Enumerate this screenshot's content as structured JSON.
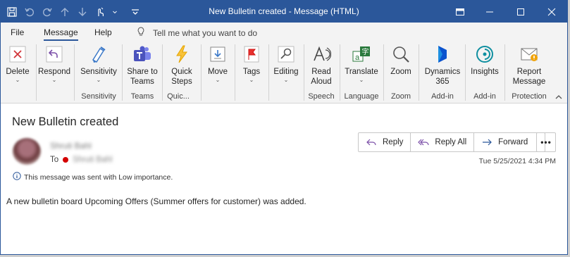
{
  "window": {
    "title": "New Bulletin created  -  Message (HTML)"
  },
  "quick_access": [
    "save-icon",
    "undo-icon",
    "redo-icon",
    "up-icon",
    "down-icon",
    "touch-mode-icon",
    "customize-icon"
  ],
  "menu_tabs": [
    {
      "label": "File"
    },
    {
      "label": "Message"
    },
    {
      "label": "Help"
    }
  ],
  "tell_me": "Tell me what you want to do",
  "ribbon": {
    "delete": "Delete",
    "respond": "Respond",
    "sensitivity": "Sensitivity",
    "share_teams": "Share to\nTeams",
    "quick_steps": "Quick\nSteps",
    "move": "Move",
    "tags": "Tags",
    "editing": "Editing",
    "read_aloud": "Read\nAloud",
    "translate": "Translate",
    "zoom": "Zoom",
    "dynamics": "Dynamics\n365",
    "insights": "Insights",
    "report_message": "Report\nMessage",
    "groups": {
      "sensitivity": "Sensitivity",
      "teams": "Teams",
      "quick": "Quic...",
      "speech": "Speech",
      "language": "Language",
      "zoom": "Zoom",
      "addin1": "Add-in",
      "addin2": "Add-in",
      "protection": "Protection"
    }
  },
  "message": {
    "subject": "New Bulletin created",
    "sender": "Shruti Bahl",
    "to_label": "To",
    "recipient": "Shruti Bahl",
    "importance_note": "This message was sent with Low importance.",
    "datetime": "Tue 5/25/2021 4:34 PM",
    "body": "A new bulletin board Upcoming Offers (Summer offers for customer) was added.",
    "actions": {
      "reply": "Reply",
      "reply_all": "Reply All",
      "forward": "Forward"
    },
    "more": "•••"
  },
  "colors": {
    "titlebar": "#2b579a",
    "ribbon_bg": "#f3f3f3",
    "delete_red": "#d13438",
    "presence_busy": "#d40000"
  }
}
